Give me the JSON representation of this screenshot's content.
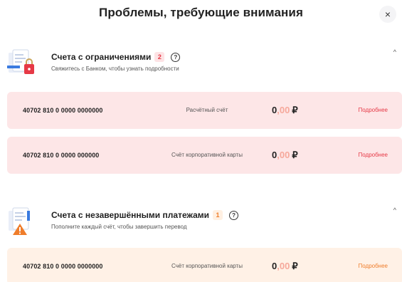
{
  "header": {
    "title": "Проблемы, требующие внимания",
    "close_glyph": "×"
  },
  "sections": [
    {
      "title": "Счета с ограничениями",
      "badge": "2",
      "help": "?",
      "subtitle": "Свяжитесь с Банком, чтобы узнать подробности",
      "icon": "documents-lock-icon",
      "accent": "#e63946",
      "rows": [
        {
          "account": "40702 810 0 0000 0000000",
          "type": "Расчётный счёт",
          "amount_int": "0",
          "amount_dec": ",00",
          "currency": "₽",
          "link": "Подробнее"
        },
        {
          "account": "40702 810 0 0000 000000",
          "type": "Счёт корпоративной карты",
          "amount_int": "0",
          "amount_dec": ",00",
          "currency": "₽",
          "link": "Подробнее"
        }
      ]
    },
    {
      "title": "Счета с незавершёнными платежами",
      "badge": "1",
      "help": "?",
      "subtitle": "Пополните каждый счёт, чтобы завершить перевод",
      "icon": "documents-warning-icon",
      "accent": "#ef7d2b",
      "rows": [
        {
          "account": "40702 810 0 0000 0000000",
          "type": "Счёт корпоративной карты",
          "amount_int": "0",
          "amount_dec": ",00",
          "currency": "₽",
          "link": "Подробнее"
        }
      ]
    }
  ],
  "colors": {
    "red_row_bg": "#fde6e7",
    "orange_row_bg": "#fff1e6",
    "decimal": "#f6a89b"
  }
}
